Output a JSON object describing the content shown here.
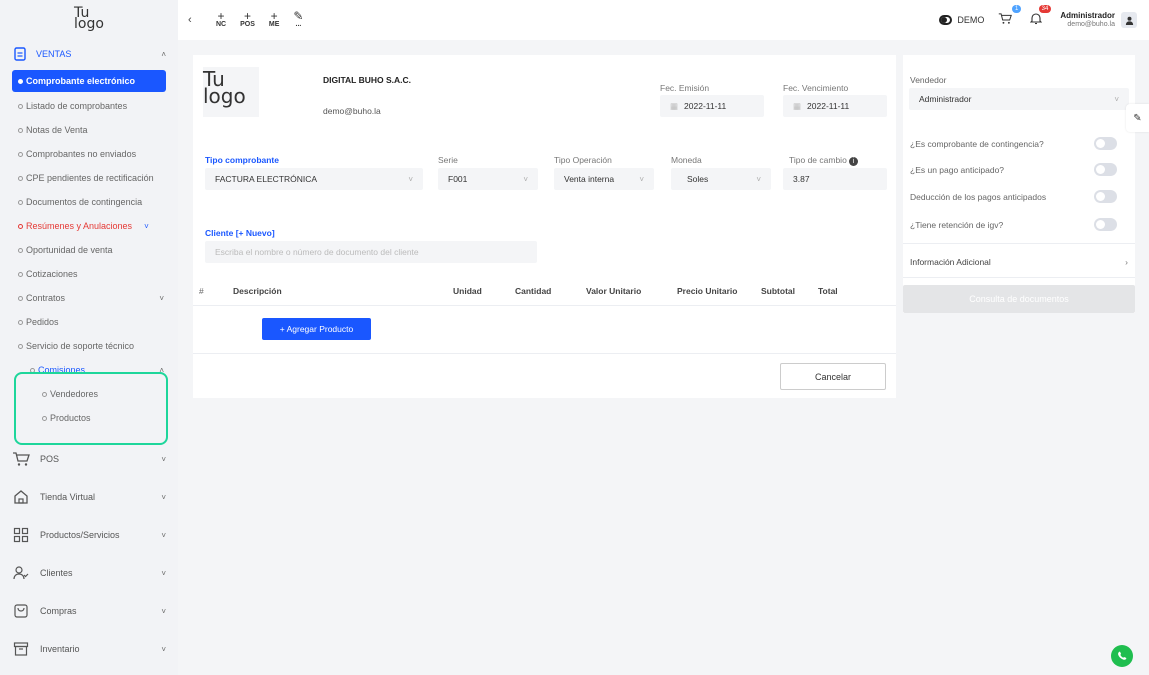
{
  "brand": {
    "logo_line1": "Tu",
    "logo_line2": "logo"
  },
  "sidebar": {
    "ventas": {
      "label": "VENTAS"
    },
    "items": [
      {
        "label": "Comprobante electrónico"
      },
      {
        "label": "Listado de comprobantes"
      },
      {
        "label": "Notas de Venta"
      },
      {
        "label": "Comprobantes no enviados"
      },
      {
        "label": "CPE pendientes de rectificación"
      },
      {
        "label": "Documentos de contingencia"
      },
      {
        "label": "Resúmenes y Anulaciones"
      },
      {
        "label": "Oportunidad de venta"
      },
      {
        "label": "Cotizaciones"
      },
      {
        "label": "Contratos"
      },
      {
        "label": "Pedidos"
      },
      {
        "label": "Servicio de soporte técnico"
      },
      {
        "label": "Comisiones"
      }
    ],
    "comisiones_sub": [
      {
        "label": "Vendedores"
      },
      {
        "label": "Productos"
      }
    ],
    "modules": [
      {
        "label": "POS",
        "icon": "cart-icon"
      },
      {
        "label": "Tienda Virtual",
        "icon": "store-icon"
      },
      {
        "label": "Productos/Servicios",
        "icon": "grid-icon"
      },
      {
        "label": "Clientes",
        "icon": "user-icon"
      },
      {
        "label": "Compras",
        "icon": "bag-icon"
      },
      {
        "label": "Inventario",
        "icon": "archive-icon"
      }
    ]
  },
  "topbar": {
    "nc": "NC",
    "pos": "POS",
    "me": "ME",
    "more": "...",
    "demo": "DEMO",
    "cart_badge": "1",
    "bell_badge": "34",
    "user_name": "Administrador",
    "user_email": "demo@buho.la"
  },
  "company": {
    "name": "DIGITAL BUHO S.A.C.",
    "email": "demo@buho.la"
  },
  "form": {
    "fec_emision_label": "Fec. Emisión",
    "fec_emision": "2022-11-11",
    "fec_venc_label": "Fec. Vencimiento",
    "fec_venc": "2022-11-11",
    "tipo_comp_label": "Tipo comprobante",
    "tipo_comp": "FACTURA ELECTRÓNICA",
    "serie_label": "Serie",
    "serie": "F001",
    "tipo_op_label": "Tipo Operación",
    "tipo_op": "Venta interna",
    "moneda_label": "Moneda",
    "moneda": "Soles",
    "tc_label": "Tipo de cambio",
    "tc": "3.87",
    "cliente_label": "Cliente [+ Nuevo]",
    "cliente_placeholder": "Escriba el nombre o número de documento del cliente"
  },
  "table": {
    "headers": [
      "#",
      "Descripción",
      "Unidad",
      "Cantidad",
      "Valor Unitario",
      "Precio Unitario",
      "Subtotal",
      "Total"
    ],
    "add_button": "+ Agregar Producto",
    "cancel_button": "Cancelar"
  },
  "right": {
    "vendedor_label": "Vendedor",
    "vendedor": "Administrador",
    "q1": "¿Es comprobante de contingencia?",
    "q2": "¿Es un pago anticipado?",
    "q3": "Deducción de los pagos anticipados",
    "q4": "¿Tiene retención de igv?",
    "info": "Información Adicional",
    "consulta": "Consulta de documentos"
  },
  "colors": {
    "accent": "#1a57ff",
    "highlight": "#1ed69b",
    "danger": "#e53935",
    "whatsapp": "#1fbe4f"
  }
}
